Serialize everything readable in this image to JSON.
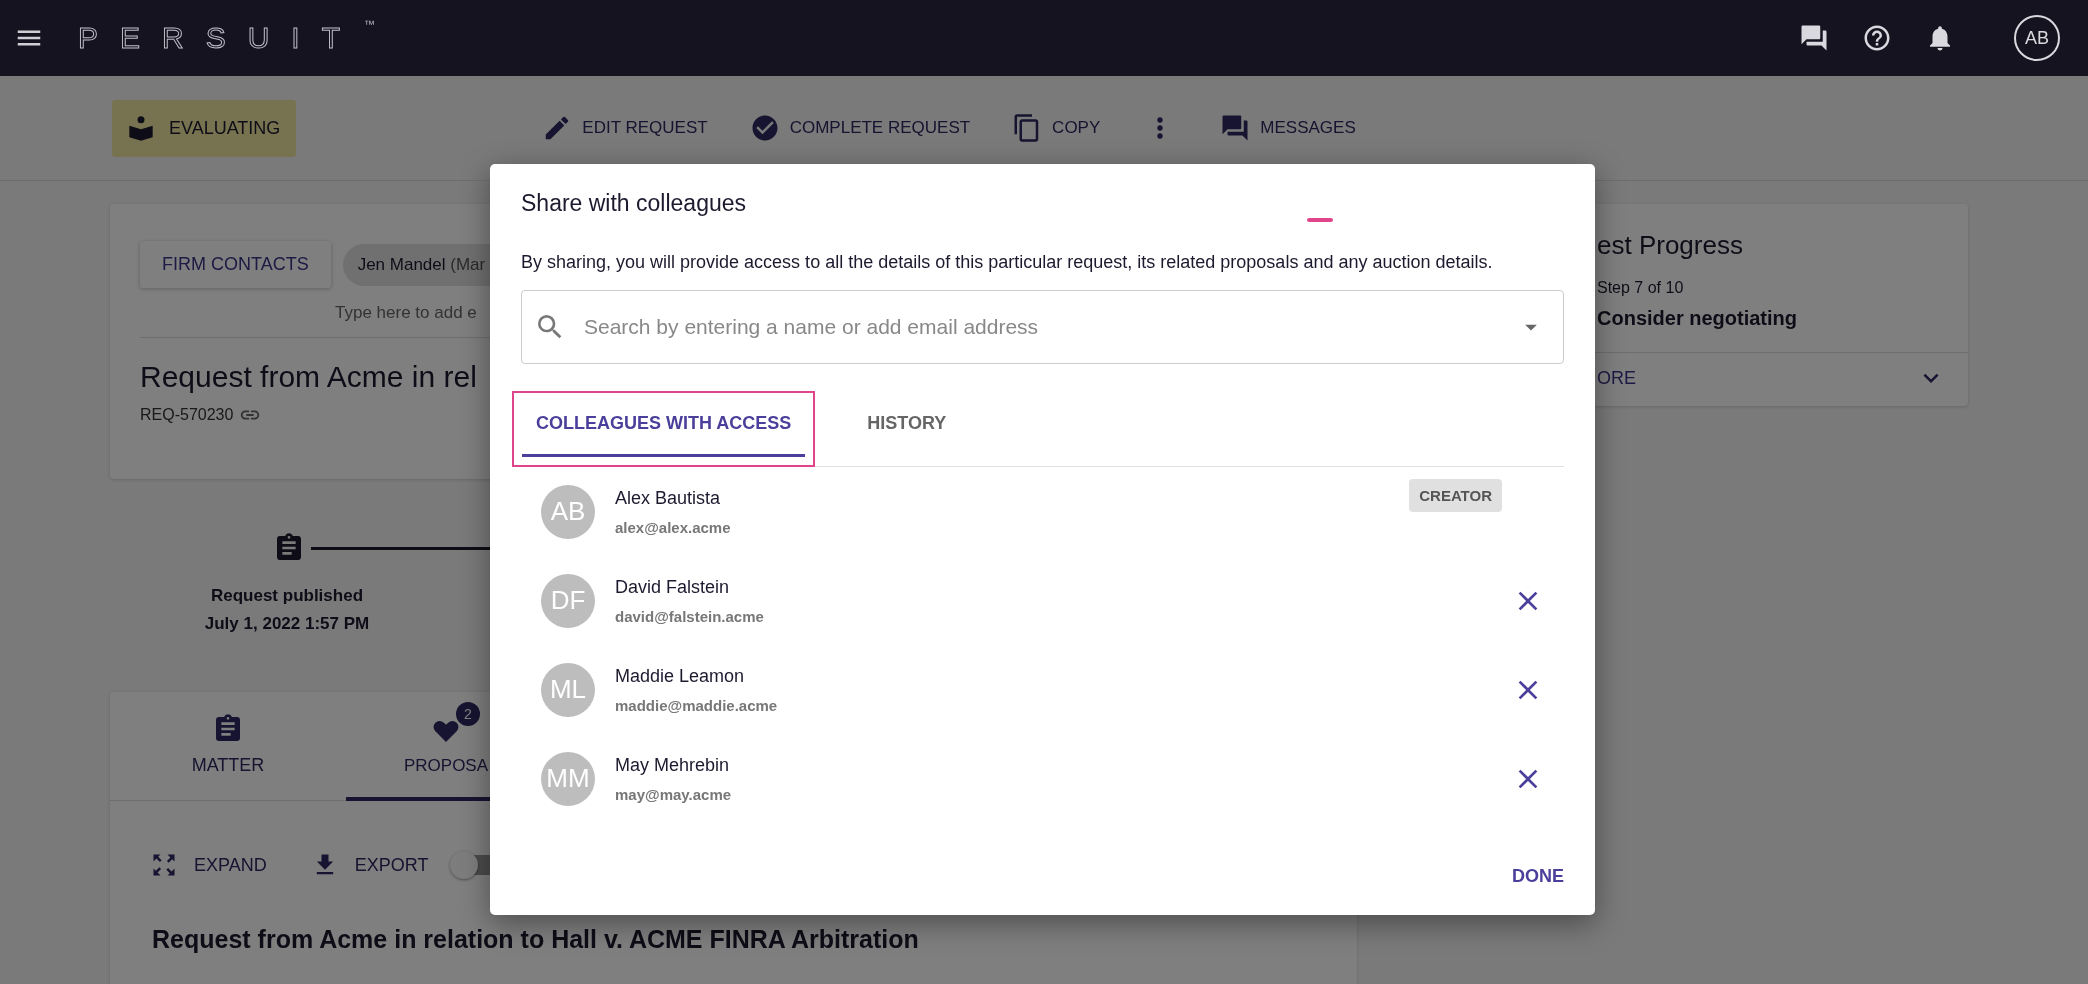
{
  "top_bar": {
    "logo": "PERSUIT",
    "logo_mark": "™",
    "user_initials": "AB"
  },
  "action_bar": {
    "status": "EVALUATING",
    "actions": [
      {
        "kind": "edit",
        "label": "EDIT REQUEST"
      },
      {
        "kind": "complete",
        "label": "COMPLETE REQUEST"
      },
      {
        "kind": "copy",
        "label": "COPY"
      },
      {
        "kind": "more"
      },
      {
        "kind": "messages",
        "label": "MESSAGES"
      }
    ]
  },
  "request_card": {
    "firm_contacts_button": "FIRM CONTACTS",
    "contact_chip": {
      "name": "Jen Mandel",
      "role": "(Mar"
    },
    "contacts_placeholder": "Type here to add e",
    "title": "Request from Acme in rel",
    "request_id": "REQ-570230"
  },
  "timeline": [
    {
      "label": "Request published",
      "date": "July 1, 2022 1:57 PM"
    }
  ],
  "content_tabs": [
    {
      "kind": "matter",
      "label": "MATTER",
      "selected": false
    },
    {
      "kind": "proposals",
      "label": "PROPOSA",
      "selected": true,
      "badge": "2"
    }
  ],
  "toolbar": {
    "actions": [
      {
        "kind": "expand",
        "label": "EXPAND"
      },
      {
        "kind": "export",
        "label": "EXPORT"
      }
    ],
    "toggle": {
      "on": false
    }
  },
  "heading": "Request from Acme in relation to Hall v. ACME FINRA Arbitration",
  "progress_card": {
    "title": "est Progress",
    "step": "Step 7 of 10",
    "current": "Consider negotiating",
    "more_link": "ORE",
    "expanded": false
  },
  "dialog": {
    "title": "Share with colleagues",
    "description": "By sharing, you will provide access to all the details of this particular request, its related proposals and any auction details.",
    "search": {
      "placeholder": "Search by entering a name or add email address"
    },
    "tabs": [
      {
        "label": "COLLEAGUES WITH ACCESS",
        "selected": true,
        "highlighted": true
      },
      {
        "label": "HISTORY",
        "selected": false,
        "highlighted": false
      }
    ],
    "colleagues": [
      {
        "initials": "AB",
        "name": "Alex Bautista",
        "email": "alex@alex.acme",
        "kind": "creator",
        "badge": "CREATOR"
      },
      {
        "initials": "DF",
        "name": "David Falstein",
        "email": "david@falstein.acme",
        "kind": "removable"
      },
      {
        "initials": "ML",
        "name": "Maddie Leamon",
        "email": "maddie@maddie.acme",
        "kind": "removable"
      },
      {
        "initials": "MM",
        "name": "May Mehrebin",
        "email": "may@may.acme",
        "kind": "removable"
      }
    ],
    "done_button": "DONE"
  }
}
